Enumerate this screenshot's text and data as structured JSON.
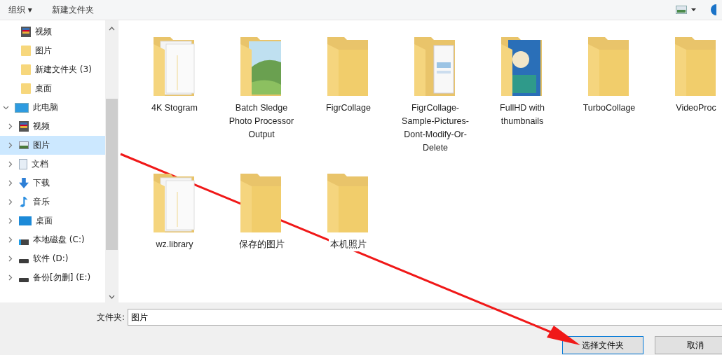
{
  "toolbar": {
    "organize": "组织 ▾",
    "new_folder": "新建文件夹"
  },
  "sidebar": {
    "quick_items": [
      {
        "label": "视频",
        "kind": "video",
        "selected": false
      },
      {
        "label": "图片",
        "kind": "folder",
        "selected": false
      },
      {
        "label": "新建文件夹 (3)",
        "kind": "folder",
        "selected": false
      },
      {
        "label": "桌面",
        "kind": "folder",
        "selected": false
      }
    ],
    "tree": [
      {
        "label": "此电脑",
        "kind": "pc",
        "expanded": true,
        "selected": false,
        "children": [
          {
            "label": "视频",
            "kind": "video",
            "expanded": false,
            "selected": false
          },
          {
            "label": "图片",
            "kind": "picture",
            "expanded": false,
            "selected": true
          },
          {
            "label": "文档",
            "kind": "doc",
            "expanded": false,
            "selected": false
          },
          {
            "label": "下载",
            "kind": "download",
            "expanded": false,
            "selected": false
          },
          {
            "label": "音乐",
            "kind": "music",
            "expanded": false,
            "selected": false
          },
          {
            "label": "桌面",
            "kind": "desktop",
            "expanded": false,
            "selected": false
          },
          {
            "label": "本地磁盘 (C:)",
            "kind": "system-drive",
            "expanded": false,
            "selected": false
          },
          {
            "label": "软件 (D:)",
            "kind": "drive",
            "expanded": false,
            "selected": false
          },
          {
            "label": "备份[勿删] (E:)",
            "kind": "drive",
            "expanded": false,
            "selected": false
          }
        ]
      }
    ]
  },
  "folders": [
    {
      "name": "4K Stogram",
      "kind": "papers"
    },
    {
      "name": "Batch Sledge Photo Processor Output",
      "kind": "photo"
    },
    {
      "name": "FigrCollage",
      "kind": "plain"
    },
    {
      "name": "FigrCollage-Sample-Pictures-Dont-Modify-Or-Delete",
      "kind": "sheets"
    },
    {
      "name": "FullHD with thumbnails",
      "kind": "artwork"
    },
    {
      "name": "TurboCollage",
      "kind": "plain"
    },
    {
      "name": "VideoProc",
      "kind": "plain"
    },
    {
      "name": "wz.library",
      "kind": "papers"
    },
    {
      "name": "保存的图片",
      "kind": "plain"
    },
    {
      "name": "本机照片",
      "kind": "plain"
    }
  ],
  "footer": {
    "folder_label": "文件夹:",
    "folder_value": "图片",
    "select_button": "选择文件夹",
    "cancel_button": "取消"
  }
}
